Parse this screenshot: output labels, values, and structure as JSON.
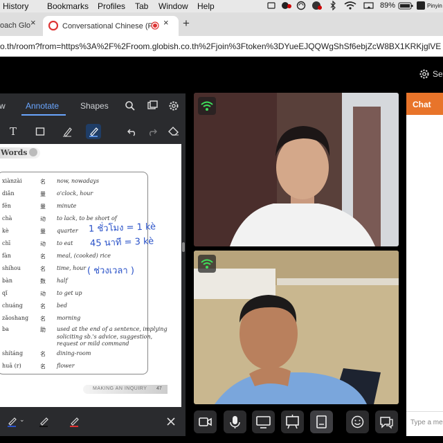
{
  "menubar": {
    "items": [
      "History",
      "Bookmarks",
      "Profiles",
      "Tab",
      "Window",
      "Help"
    ],
    "battery": "89%",
    "app_extra": "Pinyin -"
  },
  "tabs": [
    {
      "label": "oach Glo",
      "close": "×"
    },
    {
      "label": "Conversational Chinese (F",
      "close": "×"
    }
  ],
  "new_tab": "+",
  "address": {
    "url": "o.th/room?from=https%3A%2F%2Froom.globish.co.th%2Fjoin%3Ftoken%3DYueEJQQWgShSf6ebjZcW8BX1KRKjglVE"
  },
  "app_header": {
    "settings_label": "Set"
  },
  "doc_panel": {
    "tabs": [
      "w",
      "Annotate",
      "Shapes"
    ],
    "active_tab": "Annotate"
  },
  "vocab": {
    "heading": "Words",
    "rows": [
      {
        "pinyin": "xiànzài",
        "pos": "名",
        "def": "now, nowadays"
      },
      {
        "pinyin": "diǎn",
        "pos": "量",
        "def": "o'clock, hour"
      },
      {
        "pinyin": "fēn",
        "pos": "量",
        "def": "minute"
      },
      {
        "pinyin": "chà",
        "pos": "动",
        "def": "to lack, to be short of"
      },
      {
        "pinyin": "kè",
        "pos": "量",
        "def": "quarter"
      },
      {
        "pinyin": "chī",
        "pos": "动",
        "def": "to eat"
      },
      {
        "pinyin": "fàn",
        "pos": "名",
        "def": "meal, (cooked) rice"
      },
      {
        "pinyin": "shíhou",
        "pos": "名",
        "def": "time, hour"
      },
      {
        "pinyin": "bàn",
        "pos": "数",
        "def": "half"
      },
      {
        "pinyin": "qǐ",
        "pos": "动",
        "def": "to get up"
      },
      {
        "pinyin": "chuáng",
        "pos": "名",
        "def": "bed"
      },
      {
        "pinyin": "zǎoshang",
        "pos": "名",
        "def": "morning"
      },
      {
        "pinyin": "ba",
        "pos": "助",
        "def": "used at the end of a sentence, implying"
      },
      {
        "pinyin": "",
        "pos": "",
        "def": "soliciting sb.'s advice, suggestion,"
      },
      {
        "pinyin": "",
        "pos": "",
        "def": "request or mild command"
      },
      {
        "pinyin": "shítáng",
        "pos": "名",
        "def": "dining-room"
      },
      {
        "pinyin": "huā (r)",
        "pos": "名",
        "def": "flower"
      }
    ],
    "footer": "MAKING AN INQUIRY",
    "page_num": "47"
  },
  "annotations": {
    "line1": "1 ชั่วโมง = 1 kè",
    "line2": "45 นาที = 3 kè",
    "line3": "( ช่วงเวลา )"
  },
  "chat": {
    "title": "Chat",
    "placeholder": "Type a me"
  },
  "colors": {
    "accent": "#e8742a",
    "link": "#6aa6ff",
    "wifi": "#3ee05b"
  }
}
